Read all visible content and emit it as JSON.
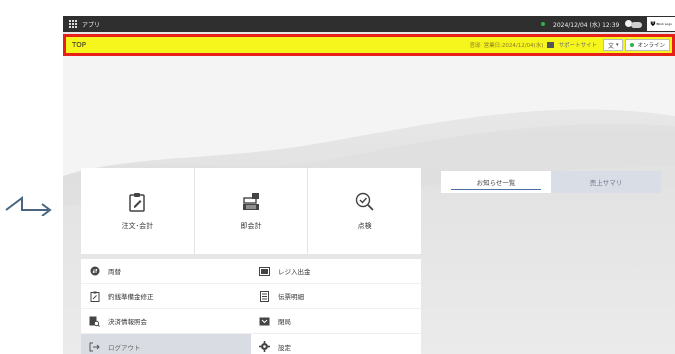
{
  "topbar": {
    "app_label": "アプリ",
    "datetime": "2024/12/04 (水) 12:39",
    "brand": "Blink Logo"
  },
  "header": {
    "title": "TOP",
    "store": "官邸",
    "business_date": "営業日:2024/12/04(水)",
    "support": "サポートサイト",
    "lang": "文",
    "status": "オンライン",
    "status_color": "#2fb34a"
  },
  "tiles": [
    {
      "label": "注文･会計",
      "icon": "clipboard-icon"
    },
    {
      "label": "即会計",
      "icon": "register-icon"
    },
    {
      "label": "点検",
      "icon": "inspect-icon"
    }
  ],
  "menu": [
    {
      "label": "両替",
      "icon": "exchange-icon"
    },
    {
      "label": "レジ入出金",
      "icon": "cash-icon"
    },
    {
      "label": "釣銭準備金修正",
      "icon": "clipboard-edit-icon"
    },
    {
      "label": "伝票明細",
      "icon": "receipt-icon"
    },
    {
      "label": "決済情報照会",
      "icon": "payment-search-icon"
    },
    {
      "label": "閉局",
      "icon": "close-shop-icon"
    },
    {
      "label": "ログアウト",
      "icon": "logout-icon"
    },
    {
      "label": "設定",
      "icon": "gear-icon"
    }
  ],
  "news": {
    "tab1": "お知らせ一覧",
    "tab2": "売上サマリ"
  },
  "colors": {
    "header_bg": "#f6f61c",
    "header_border": "#e8201a",
    "accent": "#4a6fa5"
  }
}
